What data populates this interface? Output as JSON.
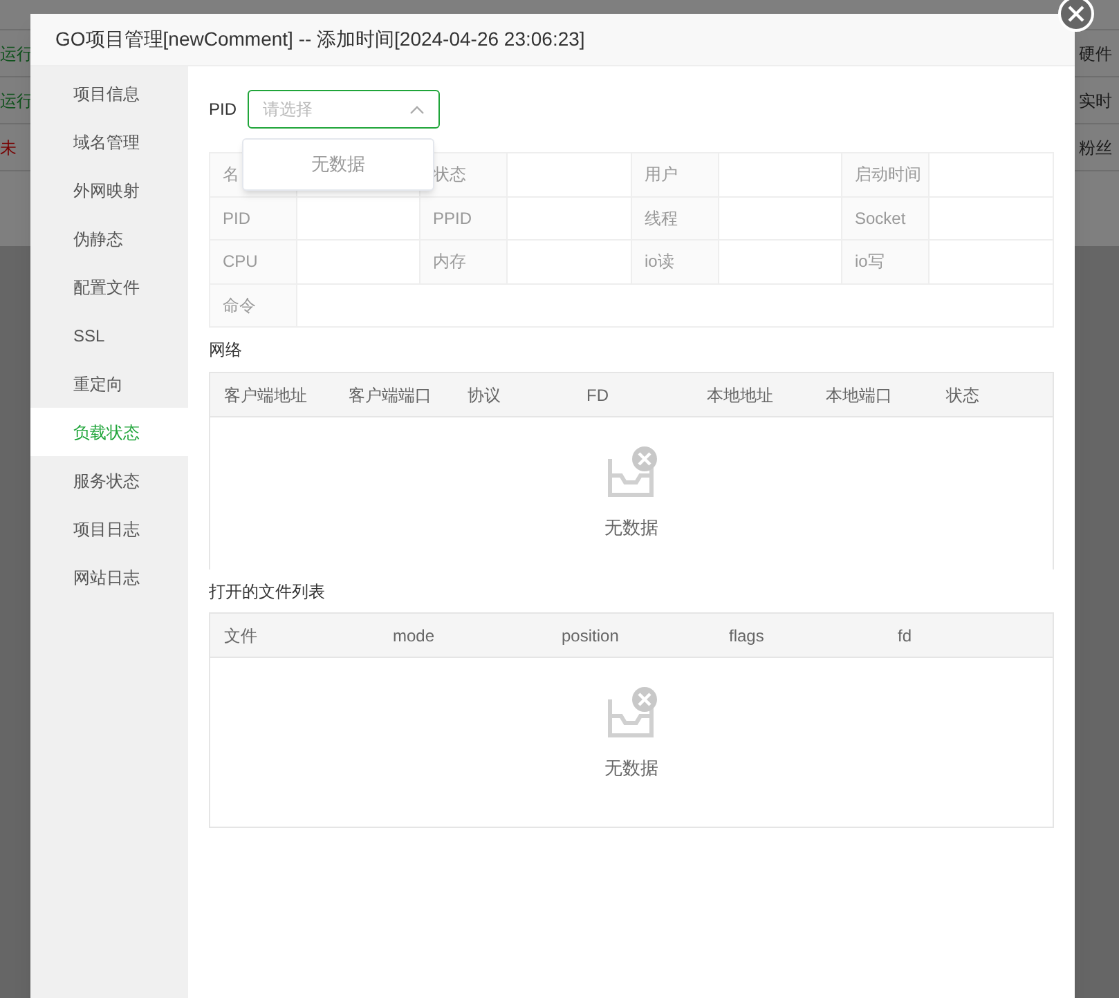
{
  "background_rows": [
    {
      "status": "运行",
      "color": "#10521d",
      "note": "硬件"
    },
    {
      "status": "运行",
      "color": "#10521d",
      "note": "实时"
    },
    {
      "status": "未",
      "color": "#770404",
      "note": "粉丝"
    }
  ],
  "modal": {
    "title": "GO项目管理[newComment] -- 添加时间[2024-04-26 23:06:23]"
  },
  "sidebar": {
    "items": [
      {
        "label": "项目信息",
        "selected": false
      },
      {
        "label": "域名管理",
        "selected": false
      },
      {
        "label": "外网映射",
        "selected": false
      },
      {
        "label": "伪静态",
        "selected": false
      },
      {
        "label": "配置文件",
        "selected": false
      },
      {
        "label": "SSL",
        "selected": false
      },
      {
        "label": "重定向",
        "selected": false
      },
      {
        "label": "负载状态",
        "selected": true
      },
      {
        "label": "服务状态",
        "selected": false
      },
      {
        "label": "项目日志",
        "selected": false
      },
      {
        "label": "网站日志",
        "selected": false
      }
    ]
  },
  "pid_select": {
    "label": "PID",
    "placeholder": "请选择",
    "expanded": true,
    "dropdown_empty": "无数据"
  },
  "info_table": {
    "rows": [
      [
        "名",
        "状态",
        "用户",
        "启动时间"
      ],
      [
        "PID",
        "PPID",
        "线程",
        "Socket"
      ],
      [
        "CPU",
        "内存",
        "io读",
        "io写"
      ],
      [
        "命令"
      ]
    ]
  },
  "network": {
    "title": "网络",
    "columns": [
      "客户端地址",
      "客户端端口",
      "协议",
      "FD",
      "本地地址",
      "本地端口",
      "状态"
    ],
    "empty": "无数据"
  },
  "open_files": {
    "title": "打开的文件列表",
    "columns": [
      "文件",
      "mode",
      "position",
      "flags",
      "fd"
    ],
    "empty": "无数据"
  }
}
